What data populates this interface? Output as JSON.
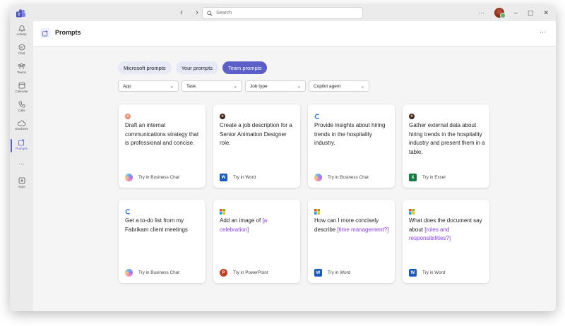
{
  "search": {
    "placeholder": "Search"
  },
  "rail": [
    {
      "label": "Activity",
      "icon": "bell-icon"
    },
    {
      "label": "Chat",
      "icon": "chat-icon"
    },
    {
      "label": "Teams",
      "icon": "teams-icon"
    },
    {
      "label": "Calendar",
      "icon": "calendar-icon"
    },
    {
      "label": "Calls",
      "icon": "phone-icon"
    },
    {
      "label": "OneDrive",
      "icon": "cloud-icon"
    },
    {
      "label": "Prompts",
      "icon": "prompts-icon",
      "active": true
    },
    {
      "label": "Apps",
      "icon": "apps-icon"
    }
  ],
  "header": {
    "title": "Prompts"
  },
  "tabs": [
    {
      "label": "Microsoft prompts",
      "active": false
    },
    {
      "label": "Your prompts",
      "active": false
    },
    {
      "label": "Team prompts",
      "active": true
    }
  ],
  "filters": [
    {
      "label": "App"
    },
    {
      "label": "Task"
    },
    {
      "label": "Job type"
    },
    {
      "label": "Copilot agent"
    }
  ],
  "cards": [
    {
      "avatar": "person-avatar-red",
      "parts": [
        {
          "text": "Draft an internal communications strategy that is professional and concise."
        }
      ],
      "action": "Try in Business Chat",
      "app": "business-chat"
    },
    {
      "avatar": "person-avatar-dark",
      "parts": [
        {
          "text": "Create a job description for a Senior Animation Designer role."
        }
      ],
      "action": "Try in Word",
      "app": "word"
    },
    {
      "avatar": "copilot-c-icon",
      "parts": [
        {
          "text": "Provide insights about hiring trends in the hospitality industry."
        }
      ],
      "action": "Try in Business Chat",
      "app": "business-chat"
    },
    {
      "avatar": "person-avatar-dark",
      "parts": [
        {
          "text": "Gather external data about hiring trends in the hospitality industry and present them in a table."
        }
      ],
      "action": "Try in Excel",
      "app": "excel"
    },
    {
      "avatar": "copilot-c-icon",
      "parts": [
        {
          "text": "Get a to-do list from my Fabrikam client meetings"
        }
      ],
      "action": "Try in Business Chat",
      "app": "business-chat"
    },
    {
      "avatar": "microsoft-logo-icon",
      "parts": [
        {
          "text": "Add an image of "
        },
        {
          "text": "[a celebration]",
          "hl": true
        }
      ],
      "action": "Try in PowerPoint",
      "app": "powerpoint"
    },
    {
      "avatar": "microsoft-logo-icon",
      "parts": [
        {
          "text": "How can I more concisely describe "
        },
        {
          "text": "[time management?]",
          "hl": true
        }
      ],
      "action": "Try in Word",
      "app": "word"
    },
    {
      "avatar": "microsoft-logo-icon",
      "parts": [
        {
          "text": "What does the document say about "
        },
        {
          "text": "[roles and responsibilities?]",
          "hl": true
        }
      ],
      "action": "Try in Word",
      "app": "word"
    }
  ],
  "colors": {
    "accent": "#5b5fc7",
    "highlight": "#8a3ffc",
    "word": "#185abd",
    "excel": "#107c41",
    "powerpoint": "#c43e1c"
  }
}
